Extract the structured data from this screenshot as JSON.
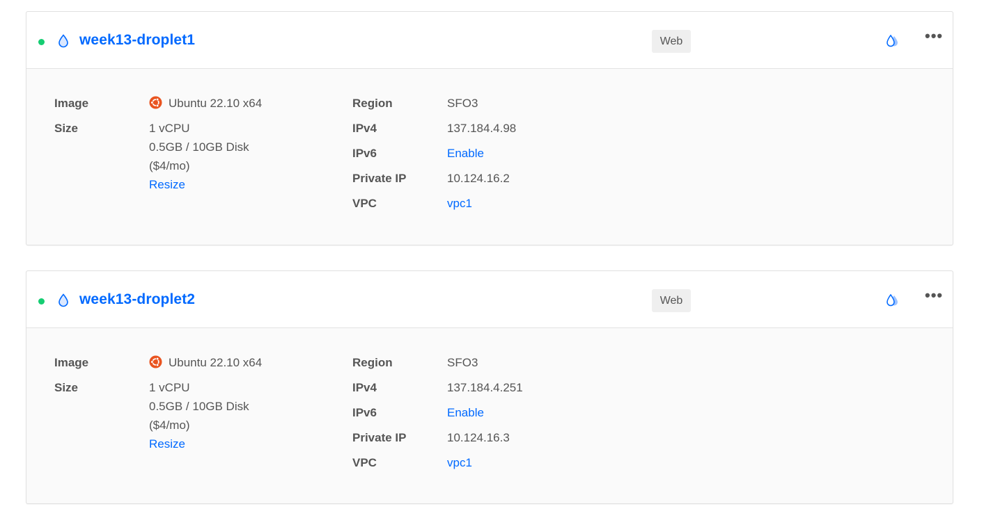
{
  "droplets": [
    {
      "name": "week13-droplet1",
      "tag": "Web",
      "image_label": "Image",
      "image_value": "Ubuntu 22.10 x64",
      "size_label": "Size",
      "size_cpu": "1 vCPU",
      "size_disk": "0.5GB / 10GB Disk",
      "size_price": "($4/mo)",
      "resize_link": "Resize",
      "region_label": "Region",
      "region_value": "SFO3",
      "ipv4_label": "IPv4",
      "ipv4_value": "137.184.4.98",
      "ipv6_label": "IPv6",
      "ipv6_value": "Enable",
      "private_ip_label": "Private IP",
      "private_ip_value": "10.124.16.2",
      "vpc_label": "VPC",
      "vpc_value": "vpc1",
      "more_label": "•••"
    },
    {
      "name": "week13-droplet2",
      "tag": "Web",
      "image_label": "Image",
      "image_value": "Ubuntu 22.10 x64",
      "size_label": "Size",
      "size_cpu": "1 vCPU",
      "size_disk": "0.5GB / 10GB Disk",
      "size_price": "($4/mo)",
      "resize_link": "Resize",
      "region_label": "Region",
      "region_value": "SFO3",
      "ipv4_label": "IPv4",
      "ipv4_value": "137.184.4.251",
      "ipv6_label": "IPv6",
      "ipv6_value": "Enable",
      "private_ip_label": "Private IP",
      "private_ip_value": "10.124.16.3",
      "vpc_label": "VPC",
      "vpc_value": "vpc1",
      "more_label": "•••"
    }
  ],
  "colors": {
    "accent": "#0069ff",
    "status_active": "#15cd72",
    "ubuntu": "#e95420"
  },
  "icons": {
    "status": "status-dot",
    "droplet": "droplet-icon",
    "image": "ubuntu-icon",
    "drops": "water-drops-icon",
    "more": "more-options-icon"
  }
}
